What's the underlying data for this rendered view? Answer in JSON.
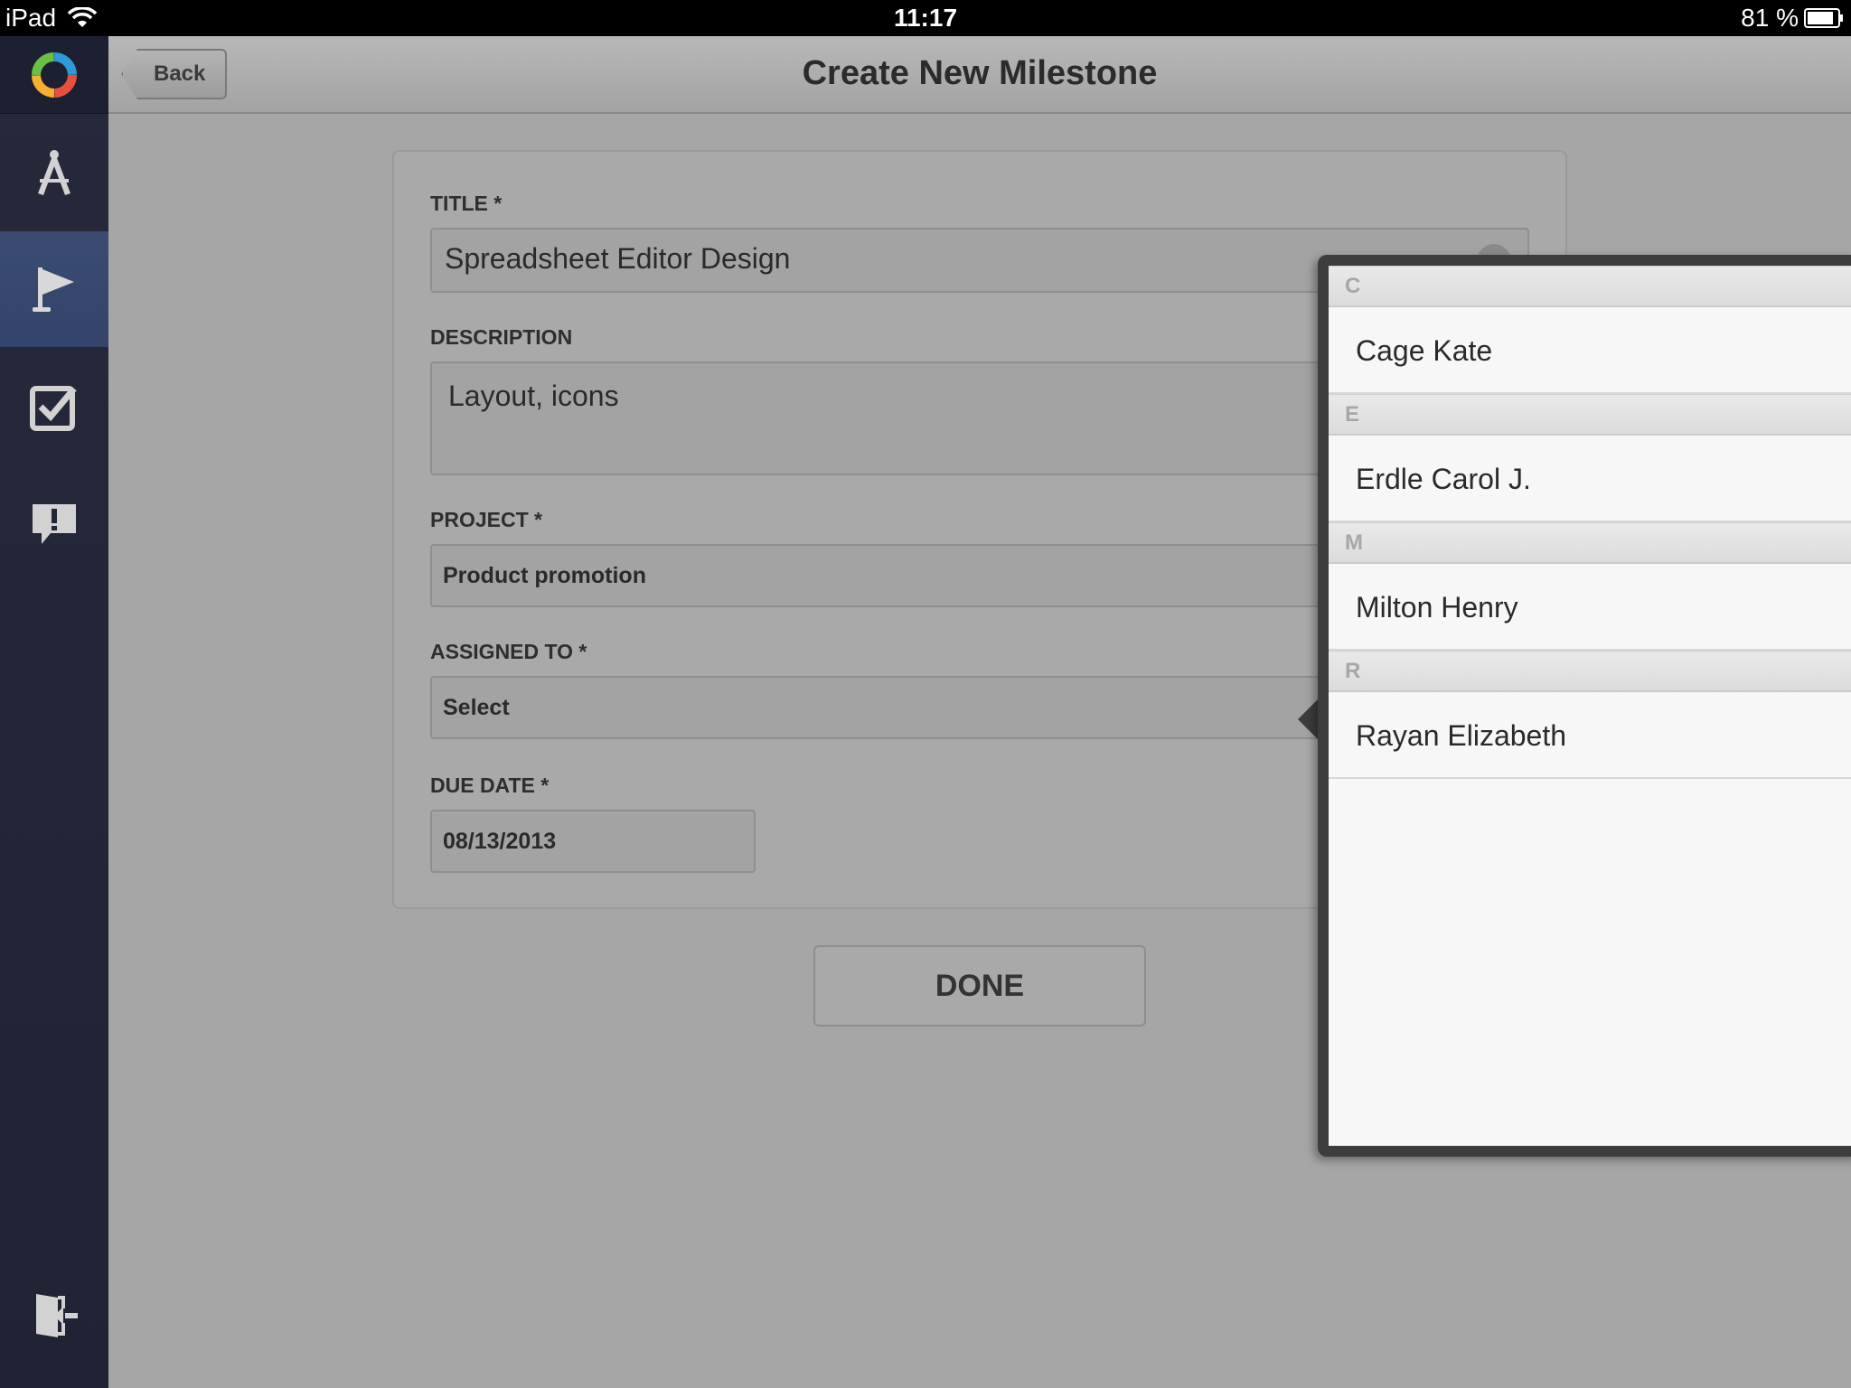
{
  "status_bar": {
    "device": "iPad",
    "time": "11:17",
    "battery": "81 %"
  },
  "header": {
    "back_label": "Back",
    "title": "Create New Milestone"
  },
  "sidebar": {
    "items": [
      {
        "icon": "compass-icon",
        "active": false
      },
      {
        "icon": "flag-icon",
        "active": true
      },
      {
        "icon": "checkbox-icon",
        "active": false
      },
      {
        "icon": "alert-bubble-icon",
        "active": false
      }
    ],
    "logout_icon": "logout-icon"
  },
  "form": {
    "title_label": "TITLE *",
    "title_value": "Spreadsheet Editor Design",
    "description_label": "DESCRIPTION",
    "description_value": "Layout, icons",
    "project_label": "PROJECT *",
    "project_value": "Product promotion",
    "assigned_label": "ASSIGNED TO *",
    "assigned_value": "Select",
    "due_label": "DUE DATE *",
    "due_value": "08/13/2013",
    "done_label": "DONE"
  },
  "assignee_popover": {
    "sections": [
      {
        "letter": "C",
        "names": [
          "Cage Kate"
        ]
      },
      {
        "letter": "E",
        "names": [
          "Erdle Carol J."
        ]
      },
      {
        "letter": "M",
        "names": [
          "Milton Henry"
        ]
      },
      {
        "letter": "R",
        "names": [
          "Rayan Elizabeth"
        ]
      }
    ]
  },
  "colors": {
    "sidebar_bg": "#23273a",
    "sidebar_active": "#37476e",
    "overlay_bg": "#a6a6a6"
  }
}
